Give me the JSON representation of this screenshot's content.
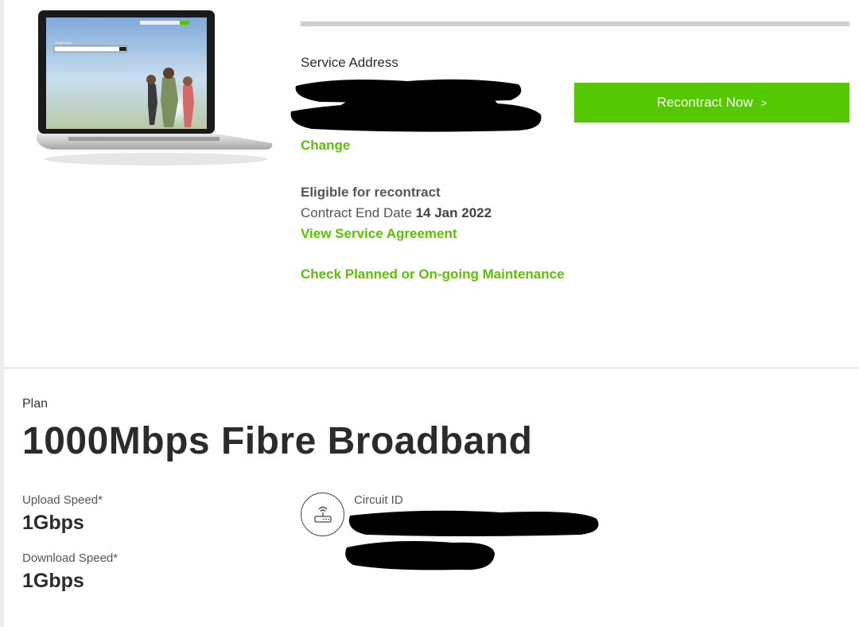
{
  "service": {
    "address_label": "Service Address",
    "change_label": "Change",
    "eligible_text": "Eligible for recontract",
    "contract_end_label": "Contract End Date",
    "contract_end_date": "14 Jan 2022",
    "agreement_link": "View Service Agreement",
    "maintenance_link": "Check Planned or On-going Maintenance",
    "recontract_button": "Recontract Now",
    "recontract_chevron": ">"
  },
  "plan": {
    "label": "Plan",
    "name": "1000Mbps Fibre Broadband",
    "upload_label": "Upload Speed*",
    "upload_value": "1Gbps",
    "download_label": "Download Speed*",
    "download_value": "1Gbps",
    "circuit_label": "Circuit ID"
  },
  "colors": {
    "accent_green": "#54c800",
    "link_green": "#5bc100",
    "redaction": "#000000"
  },
  "icons": {
    "router": "router-icon",
    "laptop": "laptop-image"
  }
}
